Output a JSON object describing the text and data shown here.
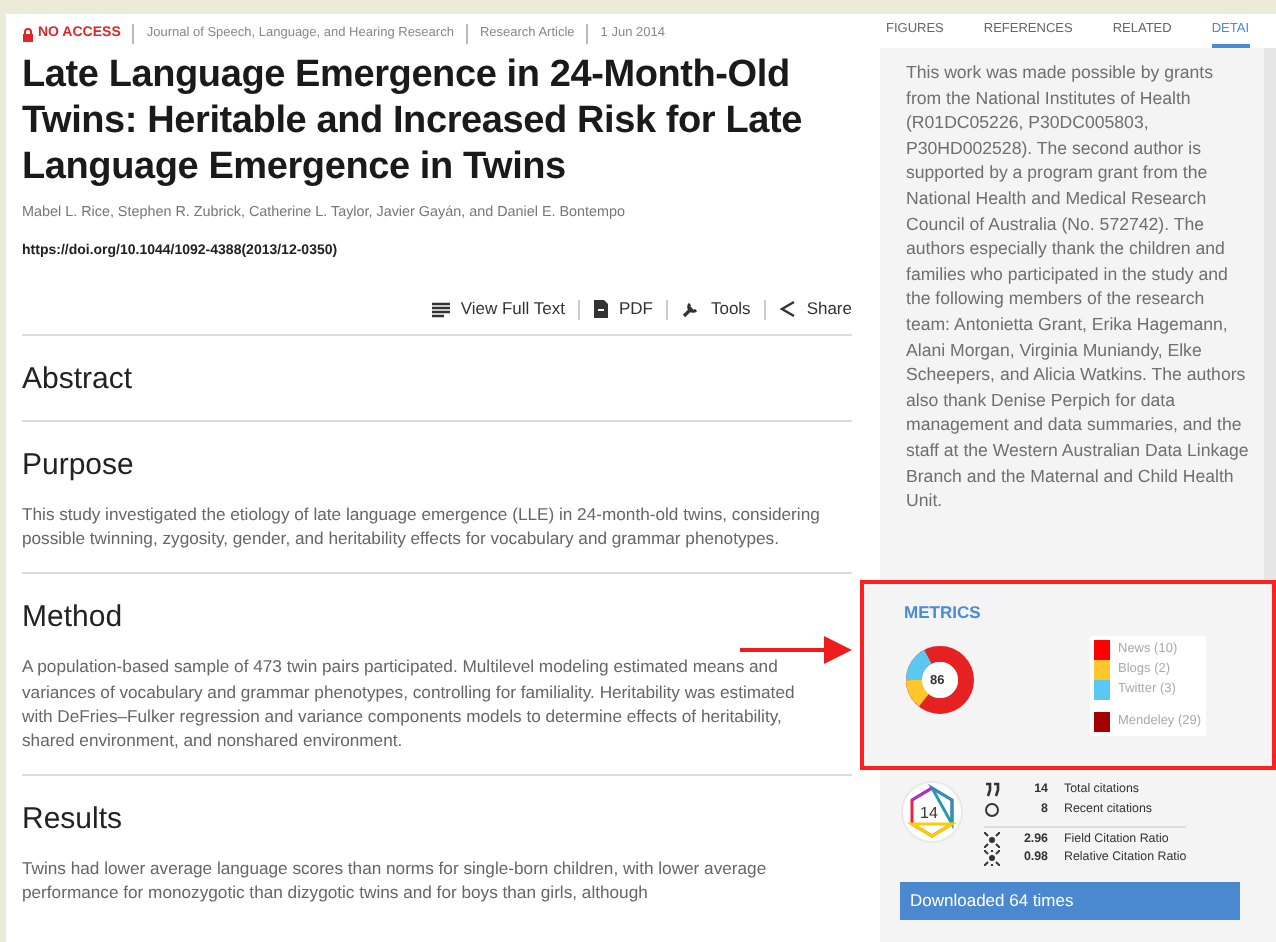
{
  "article": {
    "access": "NO ACCESS",
    "meta": [
      "Journal of Speech, Language, and Hearing Research",
      "Research Article",
      "1 Jun 2014"
    ],
    "title": "Late Language Emergence in 24-Month-Old Twins: Heritable and Increased Risk for Late Language Emergence in Twins",
    "authors": "Mabel L. Rice, Stephen R. Zubrick, Catherine L. Taylor, Javier Gayán, and Daniel E. Bontempo",
    "doi": "https://doi.org/10.1044/1092-4388(2013/12-0350)",
    "actions": [
      {
        "kind": "fulltext",
        "label": "View Full Text"
      },
      {
        "kind": "pdf",
        "label": "PDF"
      },
      {
        "kind": "tools",
        "label": "Tools"
      },
      {
        "kind": "share",
        "label": "Share"
      }
    ],
    "sections": [
      {
        "heading": "Abstract"
      },
      {
        "heading": "Purpose",
        "text": "This study investigated the etiology of late language emergence (LLE) in 24-month-old twins, considering possible twinning, zygosity, gender, and heritability effects for vocabulary and grammar phenotypes."
      },
      {
        "heading": "Method",
        "text": "A population-based sample of 473 twin pairs participated. Multilevel modeling estimated means and variances of vocabulary and grammar phenotypes, controlling for familiality. Heritability was estimated with DeFries–Fulker regression and variance components models to determine effects of heritability, shared environment, and nonshared environment."
      },
      {
        "heading": "Results",
        "text": "Twins had lower average language scores than norms for single-born children, with lower average performance for monozygotic than dizygotic twins and for boys than girls, although"
      }
    ]
  },
  "tabs": [
    {
      "label": "FIGURES",
      "selected": false
    },
    {
      "label": "REFERENCES",
      "selected": false
    },
    {
      "label": "RELATED",
      "selected": false
    },
    {
      "label": "DETAI",
      "selected": true
    }
  ],
  "details_text": "This work was made possible by grants from the National Institutes of Health (R01DC05226, P30DC005803, P30HD002528). The second author is supported by a program grant from the National Health and Medical Research Council of Australia (No. 572742). The authors especially thank the children and families who participated in the study and the following members of the research team: Antonietta Grant, Erika Hagemann, Alani Morgan, Virginia Muniandy, Elke Scheepers, and Alicia Watkins. The authors also thank Denise Perpich for data management and data summaries, and the staff at the Western Australian Data Linkage Branch and the Maternal and Child Health Unit.",
  "metrics": {
    "title": "METRICS",
    "score": "86",
    "sources": [
      {
        "label": "News (10)",
        "color": "#ff0000"
      },
      {
        "label": "Blogs (2)",
        "color": "#ffc72c"
      },
      {
        "label": "Twitter (3)",
        "color": "#5ac8f0"
      },
      {
        "label": "Mendeley (29)",
        "color": "#a50000"
      }
    ]
  },
  "citations": {
    "badge": "14",
    "stats": [
      {
        "kind": "total",
        "value": "14",
        "label": "Total citations"
      },
      {
        "kind": "recent",
        "value": "8",
        "label": "Recent citations"
      },
      {
        "kind": "field",
        "value": "2.96",
        "label": "Field Citation Ratio"
      },
      {
        "kind": "relative",
        "value": "0.98",
        "label": "Relative Citation Ratio"
      }
    ]
  },
  "download_button": "Downloaded 64 times"
}
